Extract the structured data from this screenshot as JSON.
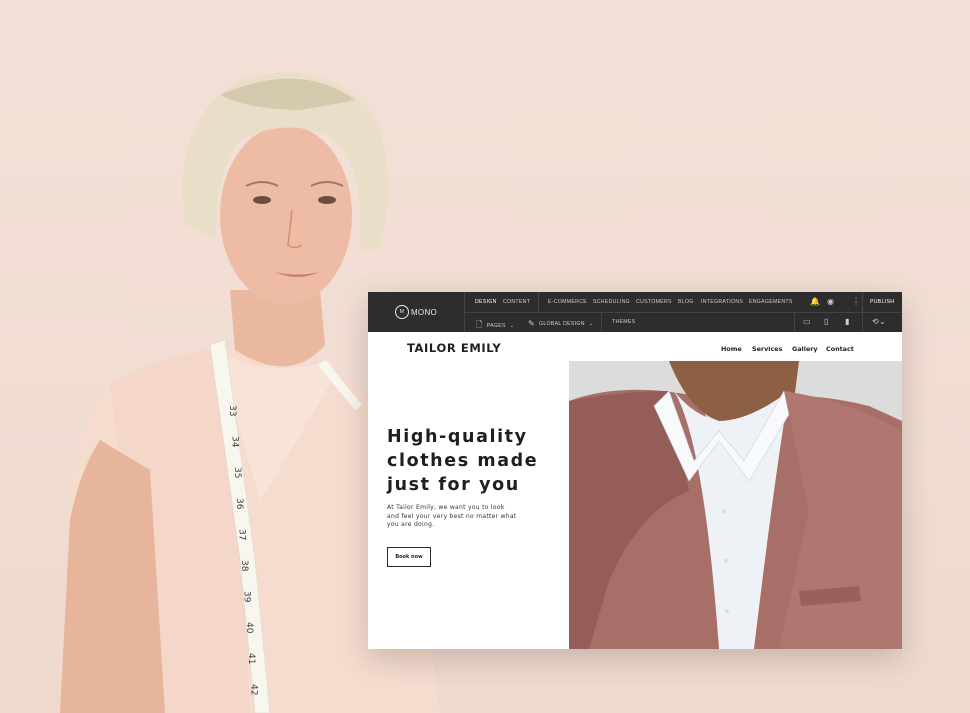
{
  "editor": {
    "logo_text": "MONO",
    "logo_mark": "M",
    "top_tabs": [
      "DESIGN",
      "CONTENT",
      "E-COMMERCE",
      "SCHEDULING",
      "CUSTOMERS",
      "BLOG",
      "INTEGRATIONS",
      "ENGAGEMENTS"
    ],
    "publish_label": "PUBLISH",
    "pages_label": "PAGES",
    "global_design_label": "GLOBAL DESIGN",
    "themes_label": "THEMES",
    "icons": [
      "bell-icon",
      "eye-icon",
      "more-icon",
      "desktop-icon",
      "tablet-icon",
      "mobile-icon",
      "history-icon",
      "page-icon",
      "design-icon"
    ]
  },
  "site": {
    "brand": "TAILOR EMILY",
    "nav": [
      "Home",
      "Services",
      "Gallery",
      "Contact"
    ],
    "headline_lines": [
      "High-quality",
      "clothes made",
      "just for you"
    ],
    "subtext_lines": [
      "At Tailor Emily, we want you to look",
      "and feel your very best no matter what",
      "you are doing."
    ],
    "cta": "Book now"
  },
  "tape_numbers": [
    "33",
    "34",
    "35",
    "36",
    "37",
    "38",
    "39",
    "40",
    "41",
    "42"
  ],
  "colors": {
    "background": "#f1ddd3",
    "toolbar": "#2d2d2d",
    "jacket": "#a86f69",
    "shirt": "#f6dccf"
  }
}
